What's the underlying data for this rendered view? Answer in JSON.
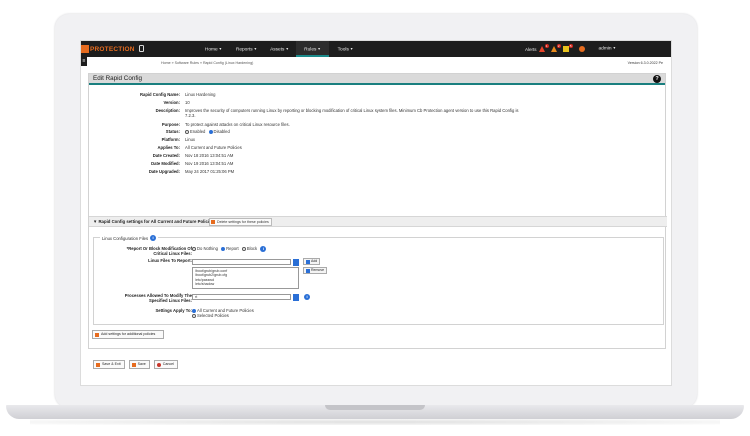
{
  "topbar": {
    "logo_text": "PROTECTION",
    "nav": [
      {
        "label": "Home"
      },
      {
        "label": "Reports"
      },
      {
        "label": "Assets"
      },
      {
        "label": "Rules"
      },
      {
        "label": "Tools"
      }
    ],
    "alerts_label": "Alerts",
    "alert_counts": [
      "1",
      "2",
      "5"
    ],
    "user": "admin"
  },
  "breadcrumb": "Home » Software Rules » Rapid Config (Linux Hardening)",
  "version": "Version 6.3.0.2022 Pe",
  "panel": {
    "title": "Edit Rapid Config",
    "help": "?"
  },
  "details": [
    {
      "label": "Rapid Config Name:",
      "value": "Linux Hardening"
    },
    {
      "label": "Version:",
      "value": "10"
    },
    {
      "label": "Description:",
      "value": "Improves the security of computers running Linux by reporting or blocking modification of critical Linux system files. Minimum Cb Protection agent version to use this Rapid Config is 7.2.3."
    },
    {
      "label": "Purpose:",
      "value": "To protect against attacks on critical Linux resource files."
    },
    {
      "label": "Status:",
      "value": ""
    },
    {
      "label": "Platform:",
      "value": "Linux"
    },
    {
      "label": "Applies To:",
      "value": "All Current and Future Policies"
    },
    {
      "label": "Date Created:",
      "value": "Nov 18 2016 13:04:51 AM"
    },
    {
      "label": "Date Modified:",
      "value": "Nov 19 2016 13:04:51 AM"
    },
    {
      "label": "Date Upgraded:",
      "value": "May 24 2017 01:25:06 PM"
    }
  ],
  "status_options": {
    "enabled": "Enabled",
    "disabled": "Disabled"
  },
  "section": {
    "title": "Rapid Config settings for All Current and Future Policies",
    "delete_label": "Delete settings for these policies"
  },
  "lcf": {
    "legend": "Linux Configuration Files",
    "report_block_label": "*Report Or Block Modification Of Critical Linux Files:",
    "rb_options": {
      "nothing": "Do Nothing",
      "report": "Report",
      "block": "Block"
    },
    "files_label": "Linux Files To Report:",
    "files": [
      "/boot/grub/grub.conf",
      "/boot/grub2/grub.cfg",
      "/etc/passwd",
      "/etc/shadow",
      "/etc/group"
    ],
    "add_label": "Add",
    "remove_label": "Remove",
    "processes_label": "Processes Allowed To Modify The Specified Linux Files:",
    "processes_value": "rt",
    "settings_apply_label": "Settings Apply To:",
    "apply_options": {
      "all": "All Current and Future Policies",
      "selected": "Selected Policies"
    }
  },
  "add_settings_label": "Add settings for additional policies",
  "footer": {
    "save_exit": "Save & Exit",
    "save": "Save",
    "cancel": "Cancel"
  }
}
